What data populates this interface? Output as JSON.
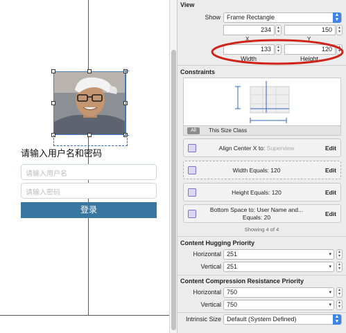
{
  "canvas": {
    "form_title": "请输入用户名和密码",
    "username_placeholder": "请输入用户名",
    "password_placeholder": "请输入密码",
    "login_label": "登录"
  },
  "inspector": {
    "view": {
      "section_title": "View",
      "show_label": "Show",
      "show_value": "Frame Rectangle",
      "x_value": "234",
      "y_value": "150",
      "x_label": "X",
      "y_label": "Y",
      "width_value": "133",
      "height_value": "120",
      "width_label": "Width",
      "height_label": "Height"
    },
    "constraints": {
      "section_title": "Constraints",
      "all_label": "All",
      "size_class_label": "This Size Class",
      "items": [
        {
          "text": "Align Center X to:",
          "target": "Superview",
          "edit": "Edit"
        },
        {
          "text": "Width Equals:  120",
          "edit": "Edit"
        },
        {
          "text": "Height Equals:  120",
          "edit": "Edit"
        },
        {
          "line1": "Bottom Space to:  User Name and...",
          "line2": "Equals:  20",
          "edit": "Edit"
        }
      ],
      "showing": "Showing 4 of 4"
    },
    "hugging": {
      "section_title": "Content Hugging Priority",
      "horizontal_label": "Horizontal",
      "horizontal_value": "251",
      "vertical_label": "Vertical",
      "vertical_value": "251"
    },
    "compression": {
      "section_title": "Content Compression Resistance Priority",
      "horizontal_label": "Horizontal",
      "horizontal_value": "750",
      "vertical_label": "Vertical",
      "vertical_value": "750"
    },
    "intrinsic": {
      "label": "Intrinsic Size",
      "value": "Default (System Defined)"
    }
  },
  "colors": {
    "guide_blue": "#2f64b8",
    "login_button": "#3a77a0",
    "annotation_red": "#d0231a",
    "popup_accent": "#3d84e6"
  }
}
